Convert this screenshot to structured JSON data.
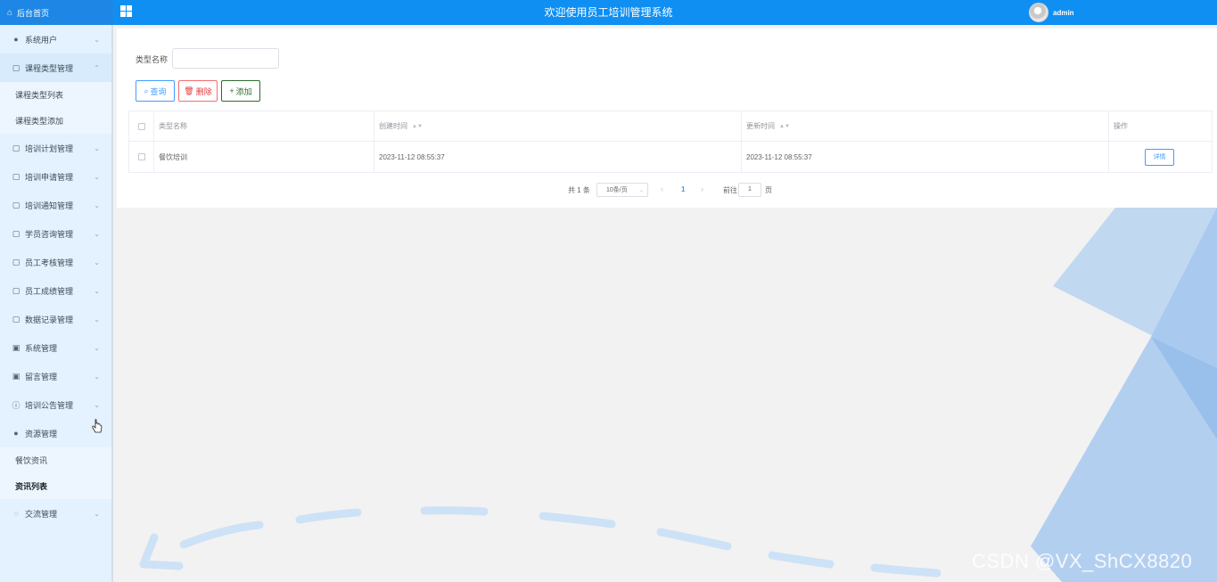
{
  "header": {
    "home_label": "后台首页",
    "title": "欢迎使用员工培训管理系统",
    "username": "admin"
  },
  "sidebar": {
    "items": [
      {
        "label": "系统用户",
        "icon": "user-icon",
        "expanded": false
      },
      {
        "label": "课程类型管理",
        "icon": "doc-icon",
        "expanded": true,
        "children": [
          "课程类型列表",
          "课程类型添加"
        ]
      },
      {
        "label": "培训计划管理",
        "icon": "doc-icon",
        "expanded": false
      },
      {
        "label": "培训申请管理",
        "icon": "doc-icon",
        "expanded": false
      },
      {
        "label": "培训通知管理",
        "icon": "doc-icon",
        "expanded": false
      },
      {
        "label": "学员咨询管理",
        "icon": "doc-icon",
        "expanded": false
      },
      {
        "label": "员工考核管理",
        "icon": "doc-icon",
        "expanded": false
      },
      {
        "label": "员工成绩管理",
        "icon": "doc-icon",
        "expanded": false
      },
      {
        "label": "数据记录管理",
        "icon": "doc-icon",
        "expanded": false
      },
      {
        "label": "系统管理",
        "icon": "picture-icon",
        "expanded": false
      },
      {
        "label": "留言管理",
        "icon": "picture-icon",
        "expanded": false
      },
      {
        "label": "培训公告管理",
        "icon": "info-icon",
        "expanded": false
      },
      {
        "label": "资源管理",
        "icon": "leaf-icon",
        "expanded": true,
        "children": [
          "餐饮资讯",
          "资讯列表"
        ],
        "active_child": "资讯列表"
      },
      {
        "label": "交流管理",
        "icon": "chat-icon",
        "expanded": false
      }
    ]
  },
  "search": {
    "label": "类型名称",
    "value": "",
    "placeholder": ""
  },
  "toolbar": {
    "query_label": "查询",
    "delete_label": "删除",
    "add_label": "添加"
  },
  "table": {
    "columns": [
      "类型名称",
      "创建时间",
      "更新时间",
      "操作"
    ],
    "rows": [
      {
        "name": "餐饮培训",
        "created": "2023-11-12 08:55:37",
        "updated": "2023-11-12 08:55:37",
        "action": "详情"
      }
    ]
  },
  "pagination": {
    "total": "共 1 条",
    "page_size": "10条/页",
    "current_page": "1",
    "goto_label": "前往",
    "goto_value": "1",
    "page_suffix": "页"
  },
  "watermark": "CSDN @VX_ShCX8820",
  "colors": {
    "header": "#0f8ff2",
    "sidebar": "#e4f1fe",
    "primary": "#409eff",
    "danger": "#f56c6c",
    "success": "#2f6b2c"
  }
}
